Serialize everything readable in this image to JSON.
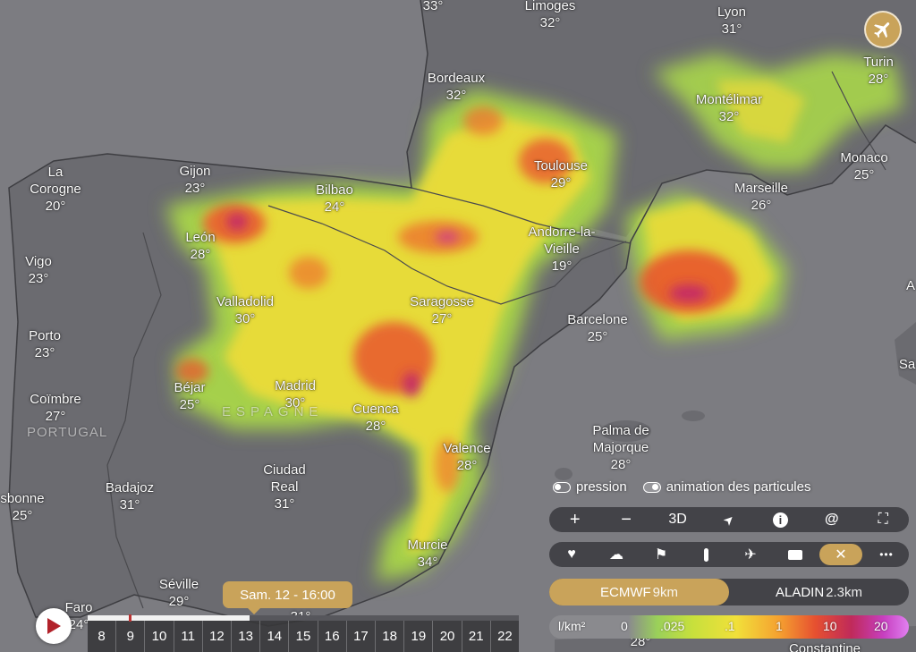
{
  "cities": [
    {
      "name": "33°",
      "temp": ""
    },
    {
      "name": "Limoges",
      "temp": "32°"
    },
    {
      "name": "Lyon",
      "temp": "31°"
    },
    {
      "name": "Turin",
      "temp": "28°"
    },
    {
      "name": "Bordeaux",
      "temp": "32°"
    },
    {
      "name": "Montélimar",
      "temp": "32°"
    },
    {
      "name": "Monaco",
      "temp": "25°"
    },
    {
      "name": "Toulouse",
      "temp": "29°"
    },
    {
      "name": "Marseille",
      "temp": "26°"
    },
    {
      "name": "La\nCorogne",
      "temp": "20°"
    },
    {
      "name": "Gijon",
      "temp": "23°"
    },
    {
      "name": "Bilbao",
      "temp": "24°"
    },
    {
      "name": "León",
      "temp": "28°"
    },
    {
      "name": "Andorre-la-\nVieille",
      "temp": "19°"
    },
    {
      "name": "Vigo",
      "temp": "23°"
    },
    {
      "name": "Valladolid",
      "temp": "30°"
    },
    {
      "name": "Saragosse",
      "temp": "27°"
    },
    {
      "name": "Barcelone",
      "temp": "25°"
    },
    {
      "name": "Porto",
      "temp": "23°"
    },
    {
      "name": "Béjar",
      "temp": "25°"
    },
    {
      "name": "Madrid",
      "temp": "30°"
    },
    {
      "name": "Cuenca",
      "temp": "28°"
    },
    {
      "name": "Coïmbre",
      "temp": "27°"
    },
    {
      "name": "Valence",
      "temp": "28°"
    },
    {
      "name": "Palma de\nMajorque",
      "temp": "28°"
    },
    {
      "name": "Ciudad\nReal",
      "temp": "31°"
    },
    {
      "name": "Badajoz",
      "temp": "31°"
    },
    {
      "name": "sbonne",
      "temp": "25°"
    },
    {
      "name": "Murcie",
      "temp": "34°"
    },
    {
      "name": "Séville",
      "temp": "29°"
    },
    {
      "name": "Faro",
      "temp": "24°"
    },
    {
      "name": "",
      "temp": "31°"
    },
    {
      "name": "",
      "temp": "28°"
    },
    {
      "name": "Constantine",
      "temp": ""
    },
    {
      "name": "A",
      "temp": ""
    },
    {
      "name": "Sa",
      "temp": ""
    }
  ],
  "countries": [
    "ESPAGNE",
    "PORTUGAL"
  ],
  "toggles": [
    {
      "label": "pression",
      "on": false
    },
    {
      "label": "animation des particules",
      "on": true
    }
  ],
  "map_controls": [
    {
      "icon": "plus-icon",
      "label": "+"
    },
    {
      "icon": "minus-icon",
      "label": "−"
    },
    {
      "icon": "3d-label",
      "label": "3D"
    },
    {
      "icon": "locate-arrow-icon",
      "label": "➤"
    },
    {
      "icon": "info-icon",
      "label": "i"
    },
    {
      "icon": "hurricane-icon",
      "label": "@"
    },
    {
      "icon": "fullscreen-icon",
      "label": "⛶"
    }
  ],
  "layer_controls": [
    {
      "icon": "heart-icon",
      "label": "♥",
      "active": false
    },
    {
      "icon": "weather-cloud-sun-icon",
      "label": "☁",
      "active": false
    },
    {
      "icon": "flag-icon",
      "label": "⚑",
      "active": false
    },
    {
      "icon": "thermometer-icon",
      "label": "🌡",
      "active": false
    },
    {
      "icon": "airplane-icon",
      "label": "✈",
      "active": false
    },
    {
      "icon": "webcam-icon",
      "label": "■",
      "active": false
    },
    {
      "icon": "close-icon",
      "label": "✕",
      "active": true
    },
    {
      "icon": "more-icon",
      "label": "•••",
      "active": false
    }
  ],
  "models": [
    {
      "name": "ECMWF",
      "res": "9km",
      "active": true
    },
    {
      "name": "ALADIN",
      "res": "2.3km",
      "active": false
    }
  ],
  "legend": {
    "unit": "l/km²",
    "ticks": [
      "0",
      ".025",
      ".1",
      "1",
      "10",
      "20"
    ]
  },
  "tooltip": "Sam. 12 - 16:00",
  "timeline": {
    "days": [
      "8",
      "9",
      "10",
      "11",
      "12",
      "13",
      "14",
      "15",
      "16",
      "17",
      "18",
      "19",
      "20",
      "21",
      "22"
    ],
    "progress": 0.375
  },
  "colors": {
    "accent": "#c9a35a",
    "land": "#6e6e72",
    "sea": "#808085"
  }
}
